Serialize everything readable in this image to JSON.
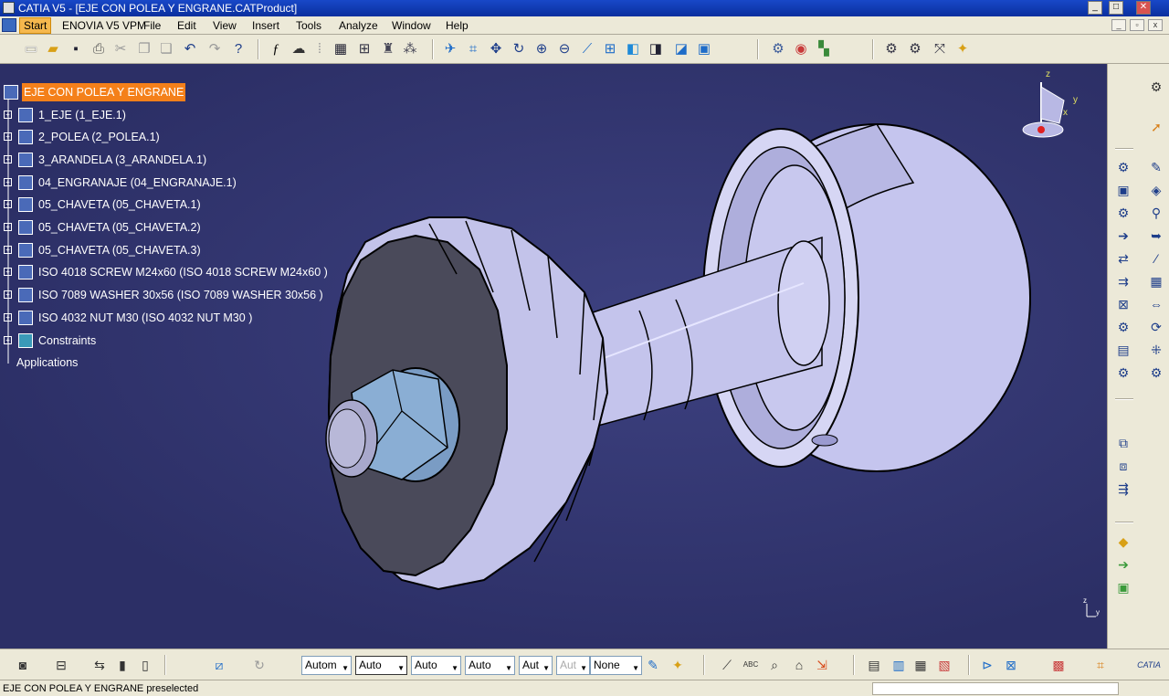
{
  "window": {
    "title": "CATIA V5 - [EJE CON POLEA Y ENGRANE.CATProduct]",
    "min": "_",
    "max": "□",
    "close": "✕"
  },
  "menu": {
    "items": [
      "Start",
      "ENOVIA V5 VPM",
      "File",
      "Edit",
      "View",
      "Insert",
      "Tools",
      "Analyze",
      "Window",
      "Help"
    ]
  },
  "toolbar_icons": [
    "new-icon",
    "open-icon",
    "save-icon",
    "print-icon",
    "cut-icon",
    "copy-icon",
    "paste-icon",
    "undo-icon",
    "redo-icon",
    "whats-this-icon",
    "formula-icon",
    "comment-icon",
    "link-icon",
    "catalog-icon",
    "product-structure-icon",
    "lock-icon",
    "manipulation-icon",
    "fly-mode-icon",
    "fit-all-icon",
    "pan-icon",
    "rotate-icon",
    "zoom-in-icon",
    "zoom-out-icon",
    "normal-view-icon",
    "multi-view-icon",
    "iso-view-icon",
    "shading-icon",
    "hide-show-icon",
    "swap-space-icon",
    "design-mode-icon",
    "catalog-browser-icon",
    "clash-icon",
    "measure-icon",
    "analysis-icon",
    "snapshot-icon"
  ],
  "tree": {
    "root": "EJE CON POLEA Y ENGRANE",
    "items": [
      "1_EJE (1_EJE.1)",
      "2_POLEA (2_POLEA.1)",
      "3_ARANDELA (3_ARANDELA.1)",
      "04_ENGRANAJE (04_ENGRANAJE.1)",
      "05_CHAVETA (05_CHAVETA.1)",
      "05_CHAVETA (05_CHAVETA.2)",
      "05_CHAVETA (05_CHAVETA.3)",
      "ISO 4018 SCREW M24x60  (ISO 4018 SCREW M24x60 )",
      "ISO 7089 WASHER 30x56 (ISO 7089 WASHER 30x56 )",
      "ISO 4032 NUT M30  (ISO 4032 NUT M30 )"
    ],
    "constraints": "Constraints",
    "applications": "Applications"
  },
  "compass": {
    "z": "z",
    "y": "y",
    "x": "x"
  },
  "bottom": {
    "combos": [
      "Autom",
      "Auto",
      "Auto",
      "Auto",
      "Aut",
      "Aut",
      "None"
    ]
  },
  "status": {
    "text": "EJE CON POLEA Y ENGRANE preselected"
  },
  "colors": {
    "viewport_bg": "#2c2f66",
    "highlight": "#f4801a",
    "part": "#c8c8ee"
  }
}
